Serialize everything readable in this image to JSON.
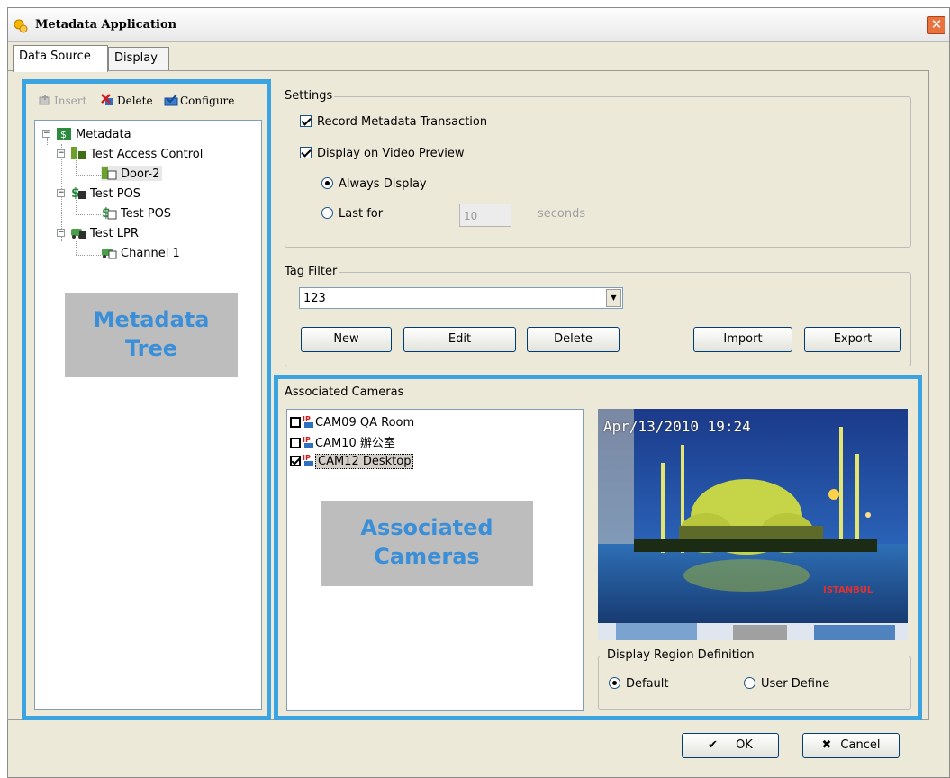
{
  "window": {
    "title": "Metadata Application",
    "close_glyph": "✕"
  },
  "tabs": [
    {
      "label": "Data Source",
      "active": true
    },
    {
      "label": "Display",
      "active": false
    }
  ],
  "toolbar": {
    "insert_label": "Insert",
    "delete_label": "Delete",
    "configure_label": "Configure"
  },
  "tree": {
    "root": "Metadata",
    "nodes": [
      {
        "label": "Test Access Control",
        "children": [
          "Door-2"
        ]
      },
      {
        "label": "Test POS",
        "children": [
          "Test POS"
        ]
      },
      {
        "label": "Test LPR",
        "children": [
          "Channel 1"
        ]
      }
    ]
  },
  "annotations": {
    "metadata_tree_line1": "Metadata",
    "metadata_tree_line2": "Tree",
    "associated_cameras_line1": "Associated",
    "associated_cameras_line2": "Cameras"
  },
  "settings": {
    "title": "Settings",
    "record_label": "Record Metadata Transaction",
    "record_checked": true,
    "display_label": "Display on Video Preview",
    "display_checked": true,
    "always_label": "Always Display",
    "last_for_label": "Last for",
    "last_for_value": "10",
    "seconds_label": "seconds"
  },
  "tag_filter": {
    "title": "Tag Filter",
    "selected": "123",
    "new_label": "New",
    "edit_label": "Edit",
    "delete_label": "Delete",
    "import_label": "Import",
    "export_label": "Export"
  },
  "cameras": {
    "title": "Associated Cameras",
    "items": [
      {
        "label": "CAM09 QA Room",
        "checked": false
      },
      {
        "label": "CAM10 辦公室",
        "checked": false
      },
      {
        "label": "CAM12 Desktop",
        "checked": true
      }
    ],
    "preview_timestamp": "Apr/13/2010 19:24",
    "preview_brand": "ISTANBUL"
  },
  "region": {
    "title": "Display Region Definition",
    "default_label": "Default",
    "user_define_label": "User Define"
  },
  "footer": {
    "ok_label": "OK",
    "cancel_label": "Cancel"
  },
  "colors": {
    "highlight": "#3aa3e0",
    "annotation_text": "#3a8fd8",
    "annotation_bg": "#bdbdbd",
    "dialog_bg": "#ece9d8"
  }
}
